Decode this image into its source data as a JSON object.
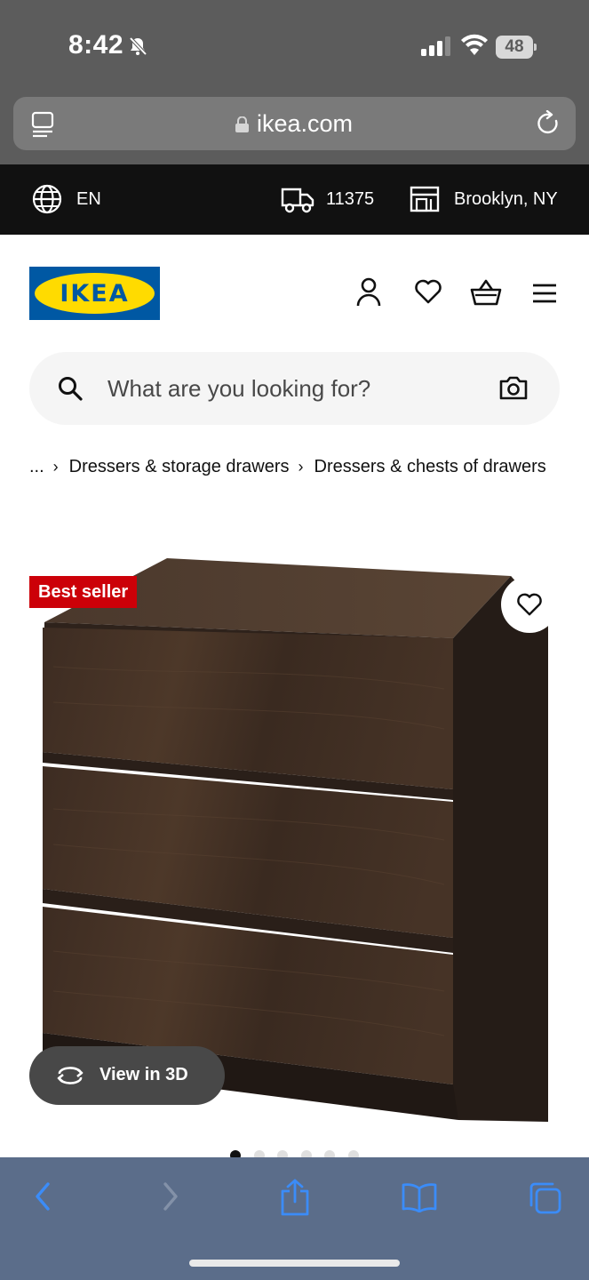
{
  "status": {
    "time": "8:42",
    "battery": "48"
  },
  "browser": {
    "url": "ikea.com"
  },
  "top_strip": {
    "language": "EN",
    "zip": "11375",
    "store": "Brooklyn, NY"
  },
  "logo": {
    "text": "IKEA"
  },
  "search": {
    "placeholder": "What are you looking for?"
  },
  "breadcrumb": {
    "ellipsis": "...",
    "items": [
      "Dressers & storage drawers",
      "Dressers & chests of drawers"
    ]
  },
  "product": {
    "badge": "Best seller",
    "view3d_label": "View in 3D"
  },
  "carousel": {
    "count": 6,
    "active": 1
  },
  "colors": {
    "ikea_blue": "#0058a3",
    "ikea_yellow": "#ffdb00",
    "badge_red": "#cc0008",
    "safari_blue": "#3b8cf8"
  }
}
